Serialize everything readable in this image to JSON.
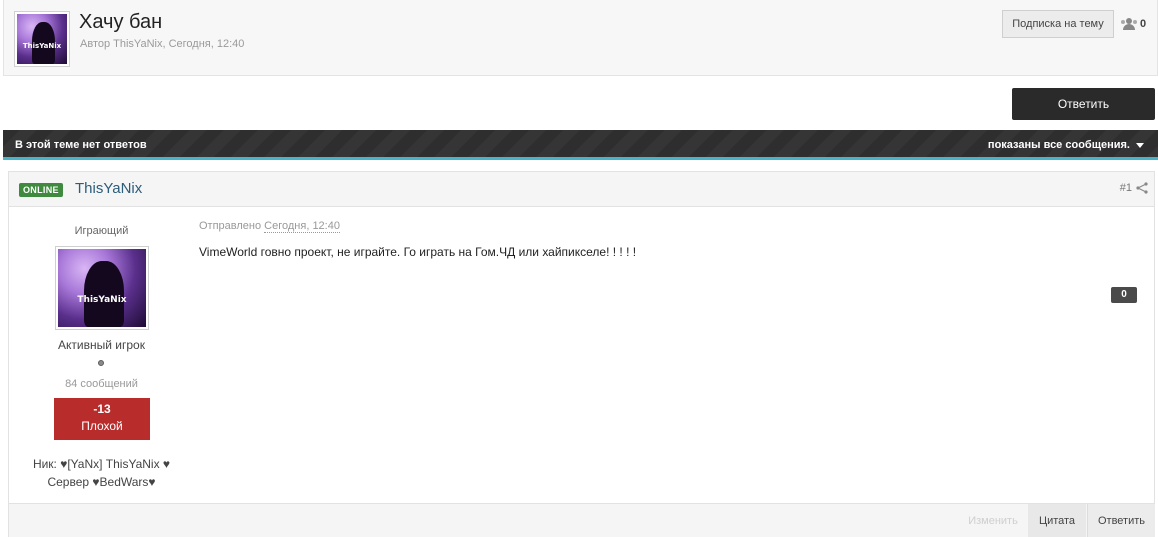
{
  "topic": {
    "title": "Хачу бан",
    "author_prefix": "Автор",
    "author": "ThisYaNix,",
    "date": "Сегодня, 12:40",
    "follow_label": "Подписка на тему",
    "followers_count": "0",
    "avatar_signature": "ThisYaNix"
  },
  "actions": {
    "reply_label": "Ответить"
  },
  "bar": {
    "left_text": "В этой теме нет ответов",
    "right_text": "показаны все сообщения."
  },
  "post": {
    "online_label": "ONLINE",
    "author": "ThisYaNix",
    "number": "#1",
    "user_title": "Играющий",
    "avatar_signature": "ThisYaNix",
    "rank": "Активный игрок",
    "post_count": "84 сообщений",
    "reputation_value": "-13",
    "reputation_label": "Плохой",
    "field_nick": "Ник: ♥[YaNx] ThisYaNix ♥",
    "field_server": "Сервер ♥BedWars♥",
    "posted_prefix": "Отправлено",
    "posted_date": "Сегодня, 12:40",
    "body": "VimeWorld говно проект, не играйте. Го играть на Гом.ЧД или хайпикселе! ! ! ! !",
    "rep_count": "0",
    "foot": {
      "edit_label": "Изменить",
      "quote_label": "Цитата",
      "reply_label": "Ответить"
    }
  },
  "colors": {
    "reputation_negative": "#b92c2c",
    "online": "#3f8a3f",
    "accent_line": "#49b3c9",
    "author_link": "#2c5d7a"
  },
  "icons": [
    "people-icon",
    "share-icon",
    "chevron-down-icon"
  ]
}
